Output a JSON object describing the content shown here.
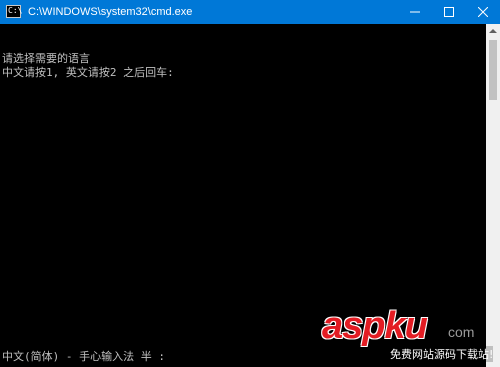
{
  "window": {
    "title": "C:\\WINDOWS\\system32\\cmd.exe",
    "icon": "console-app-icon",
    "icon_glyph": "C:\\",
    "controls": {
      "minimize_icon": "minimize-icon",
      "maximize_icon": "maximize-icon",
      "close_icon": "close-icon"
    },
    "colors": {
      "titlebar": "#0078d7",
      "console_bg": "#000000",
      "console_text": "#c0c0c0"
    }
  },
  "console": {
    "lines": [
      "请选择需要的语言",
      "中文请按1, 英文请按2 之后回车:"
    ],
    "ime_status": "中文(简体) - 手心输入法 半 :"
  },
  "watermark": {
    "logo": "aspku",
    "domain": "com",
    "slogan": "免费网站源码下载站!"
  }
}
